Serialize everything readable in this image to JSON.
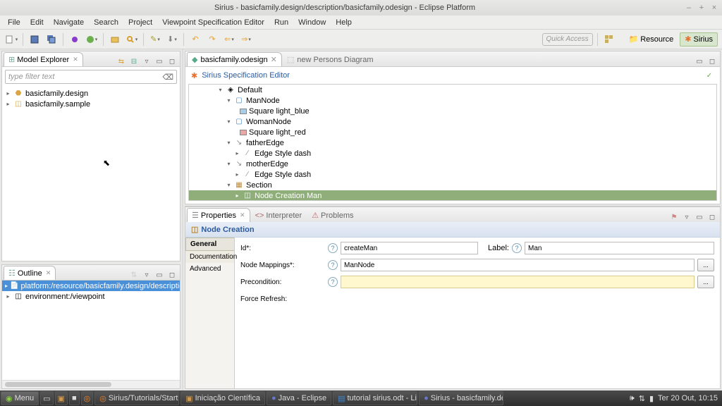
{
  "window": {
    "title": "Sirius - basicfamily.design/description/basicfamily.odesign - Eclipse Platform"
  },
  "menubar": [
    "File",
    "Edit",
    "Navigate",
    "Search",
    "Project",
    "Viewpoint Specification Editor",
    "Run",
    "Window",
    "Help"
  ],
  "toolbar": {
    "quick_access_placeholder": "Quick Access",
    "perspectives": {
      "resource": "Resource",
      "sirius": "Sirius"
    }
  },
  "model_explorer": {
    "title": "Model Explorer",
    "filter_placeholder": "type filter text",
    "items": [
      "basicfamily.design",
      "basicfamily.sample"
    ]
  },
  "outline": {
    "title": "Outline",
    "items": [
      "platform:/resource/basicfamily.design/description/basicfamily.o",
      "environment:/viewpoint"
    ]
  },
  "editor": {
    "tab_active": "basicfamily.odesign",
    "tab_inactive": "new Persons Diagram",
    "header": "Sirius Specification Editor",
    "tree": {
      "default": "Default",
      "man_node": "ManNode",
      "man_style": "Square light_blue",
      "woman_node": "WomanNode",
      "woman_style": "Square light_red",
      "father_edge": "fatherEdge",
      "father_style": "Edge Style dash",
      "mother_edge": "motherEdge",
      "mother_style": "Edge Style dash",
      "section": "Section",
      "node_creation": "Node Creation Man"
    }
  },
  "bottom_view": {
    "tabs": {
      "properties": "Properties",
      "interpreter": "Interpreter",
      "problems": "Problems"
    },
    "header": "Node Creation",
    "left_tabs": {
      "general": "General",
      "documentation": "Documentation",
      "advanced": "Advanced"
    },
    "form": {
      "id_label": "Id*:",
      "id_value": "createMan",
      "label_label": "Label:",
      "label_value": "Man",
      "node_mappings_label": "Node Mappings*:",
      "node_mappings_value": "ManNode",
      "precondition_label": "Precondition:",
      "force_refresh_label": "Force Refresh:",
      "more_btn": "..."
    }
  },
  "taskbar": {
    "menu": "Menu",
    "items": [
      "Sirius/Tutorials/Starte...",
      "Iniciação Científica",
      "Java - Eclipse",
      "tutorial sirius.odt - Lib...",
      "Sirius - basicfamily.de..."
    ],
    "clock": "Ter 20 Out, 10:15"
  }
}
